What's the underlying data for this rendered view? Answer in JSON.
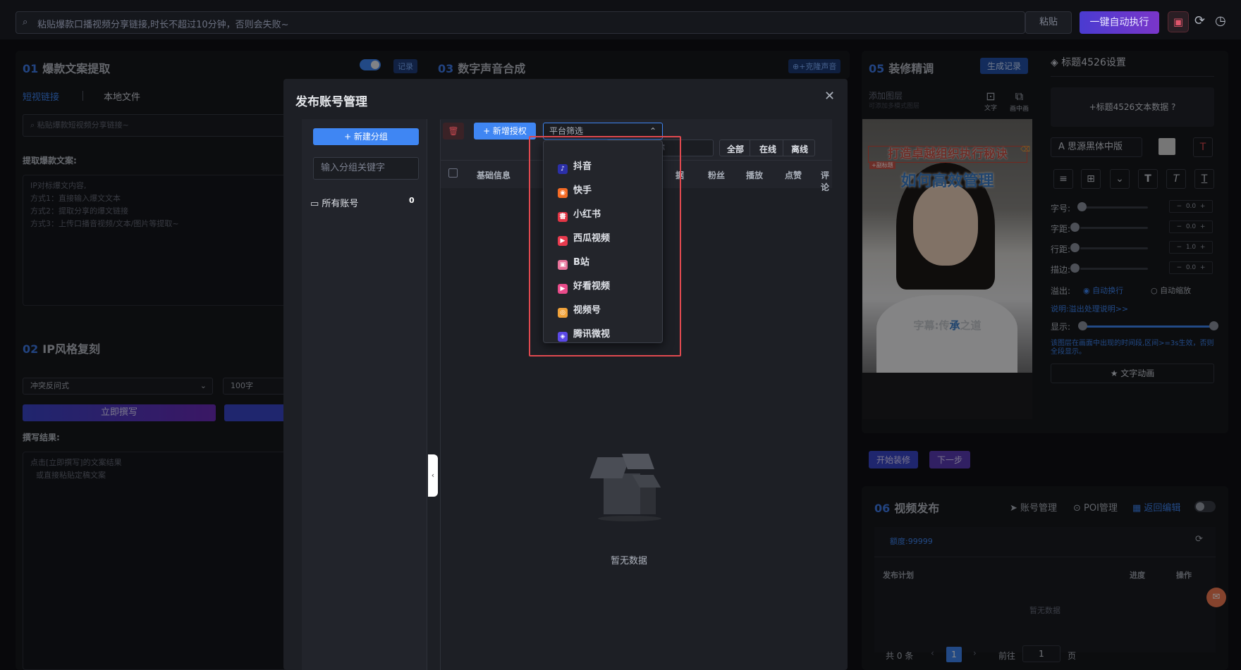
{
  "topbar": {
    "placeholder": "粘贴爆款口播视频分享链接,时长不超过10分钟，否则会失败~",
    "paste": "粘贴",
    "run": "一键自动执行"
  },
  "p01": {
    "num": "01",
    "title": "爆款文案提取",
    "record": "记录",
    "tab_link": "短视链接",
    "tab_local": "本地文件",
    "input_ph": "粘贴爆款短视频分享链接~",
    "extract_label": "提取爆款文案:",
    "textarea": [
      "IP对标爆文内容,",
      "方式1：直接输入爆文文本",
      "方式2：提取分享的爆文链接",
      "方式3：上传口播音视频/文本/图片等提取~"
    ]
  },
  "p02": {
    "num": "02",
    "title": "IP风格复刻",
    "style": "冲突反问式",
    "words": "100字",
    "write": "立即撰写",
    "result_label": "撰写结果:",
    "result_ph": [
      "点击[立即撰写]的文案结果",
      "或直接粘贴定稿文案"
    ]
  },
  "p03": {
    "num": "03",
    "title": "数字声音合成",
    "clone": "+克隆声音"
  },
  "p05": {
    "num": "05",
    "title": "装修精调",
    "gen": "生成记录",
    "add_layer": "添加图层",
    "add_layer_sub": "可添加多模式图层",
    "text_tool": "文字",
    "pip_tool": "画中画",
    "overlay_title1": "打造卓越组织执行秘诀",
    "overlay_sub": "+副标题",
    "overlay_title2": "如何高效管理",
    "subtitle_a": "字幕:传",
    "subtitle_b": "承",
    "subtitle_c": "之道",
    "start": "开始装修",
    "next": "下一步"
  },
  "settings": {
    "title": "标题4526设置",
    "add_text": "+标题4526文本数据",
    "font": "思源黑体中版",
    "size_label": "字号:",
    "size_val": "0.0",
    "spacing_label": "字距:",
    "spacing_val": "0.0",
    "line_label": "行距:",
    "line_val": "1.0",
    "stroke_label": "描边:",
    "stroke_val": "0.0",
    "overflow_label": "溢出:",
    "overflow_wrap": "自动换行",
    "overflow_scale": "自动缩放",
    "overflow_note": "说明:溢出处理说明>>",
    "show_label": "显示:",
    "show_note": "该图层在画面中出现的时间段,区间>=3s生效，否则全段显示。",
    "anim": "文字动画"
  },
  "p06": {
    "num": "06",
    "title": "视频发布",
    "account": "账号管理",
    "poi": "POI管理",
    "back": "返回编辑",
    "quota": "额度:99999",
    "plan": "发布计划",
    "progress": "进度",
    "ops": "操作",
    "empty": "暂无数据",
    "total": "共 0 条",
    "page": "1",
    "goto": "前往",
    "goto_val": "1",
    "page_unit": "页"
  },
  "modal": {
    "title": "发布账号管理",
    "new_group": "+ 新建分组",
    "group_ph": "输入分组关键字",
    "all_accounts": "所有账号",
    "all_count": "0",
    "new_auth": "+ 新增授权",
    "platform_filter": "平台筛选",
    "name_ph": "输入账号名称",
    "filter_all": "全部",
    "filter_online": "在线",
    "filter_offline": "离线",
    "col_basic": "基础信息",
    "col_fans": "粉丝",
    "col_play": "播放",
    "col_like": "点赞",
    "col_comment": "评论",
    "col_hidden": "据",
    "empty": "暂无数据"
  },
  "platforms": [
    {
      "name": "抖音",
      "color": "#2b2fa8",
      "glyph": "♪"
    },
    {
      "name": "快手",
      "color": "#f56b25",
      "glyph": "◉"
    },
    {
      "name": "小红书",
      "color": "#e23545",
      "glyph": "書"
    },
    {
      "name": "西瓜视频",
      "color": "#e83a4e",
      "glyph": "▶"
    },
    {
      "name": "B站",
      "color": "#e8729a",
      "glyph": "▣"
    },
    {
      "name": "好看视频",
      "color": "#e94b8a",
      "glyph": "▶"
    },
    {
      "name": "视频号",
      "color": "#f0a23a",
      "glyph": "◎"
    },
    {
      "name": "腾讯微视",
      "color": "#5b49e6",
      "glyph": "◈"
    }
  ]
}
